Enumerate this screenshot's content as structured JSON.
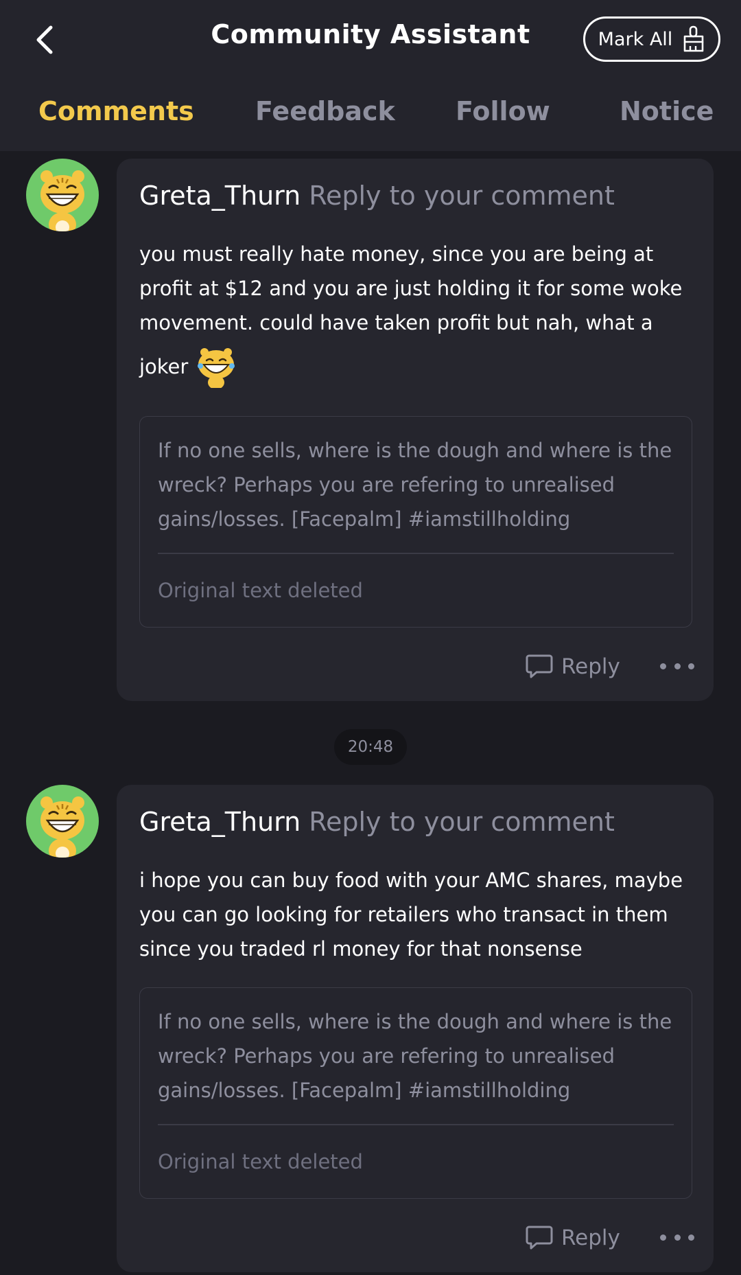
{
  "header": {
    "title": "Community Assistant",
    "mark_all_label": "Mark All"
  },
  "tabs": [
    {
      "label": "Comments",
      "active": true
    },
    {
      "label": "Feedback",
      "active": false
    },
    {
      "label": "Follow",
      "active": false
    },
    {
      "label": "Notice",
      "active": false
    }
  ],
  "notifications": [
    {
      "username": "Greta_Thurn",
      "action": " Reply to your comment",
      "lines": [
        "you must really hate money, since you are being at",
        "profit at $12 and you are just holding it for some woke",
        "movement. could have taken profit but nah, what a",
        "joker"
      ],
      "emoji": "laughing-tiger-sticker",
      "quote": {
        "text": "If no one sells, where is the dough and where is the wreck? Perhaps you are refering to unrealised gains/losses. [Facepalm] #iamstillholding",
        "original_status": "Original text deleted"
      },
      "reply_label": "Reply"
    },
    {
      "username": "Greta_Thurn",
      "action": " Reply to your comment",
      "lines": [
        "i hope you can buy food with your AMC shares, maybe",
        "you can go looking for retailers who transact in them",
        "since you traded rl money for that nonsense"
      ],
      "quote": {
        "text": "If no one sells, where is the dough and where is the wreck? Perhaps you are refering to unrealised gains/losses. [Facepalm] #iamstillholding",
        "original_status": "Original text deleted"
      },
      "reply_label": "Reply"
    }
  ],
  "timestamp": "20:48",
  "colors": {
    "background": "#1b1b21",
    "card": "#26262e",
    "accent": "#f3c94c",
    "muted": "#8e8f9e",
    "avatar_bg": "#6fca6a"
  }
}
